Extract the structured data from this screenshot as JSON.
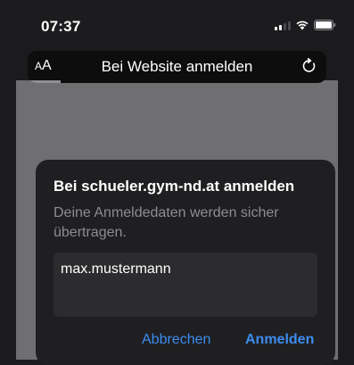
{
  "status_bar": {
    "time": "07:37",
    "signal_icon": "cellular-signal-icon",
    "wifi_icon": "wifi-icon",
    "battery_icon": "battery-icon"
  },
  "url_bar": {
    "text_size_label_small": "A",
    "text_size_label_large": "A",
    "title": "Bei Website anmelden",
    "reload_icon": "reload-icon",
    "load_progress": 0.11
  },
  "dialog": {
    "title": "Bei schueler.gym-nd.at anmelden",
    "message": "Deine Anmeldedaten werden sicher übertragen.",
    "username_value": "max.mustermann",
    "cancel_label": "Abbrechen",
    "login_label": "Anmelden"
  },
  "colors": {
    "accent": "#3d8cf0",
    "background": "#1c1c1e",
    "dialog_background": "#1f1f21",
    "field_background": "#2c2c2e",
    "secondary_text": "#8d8d92"
  }
}
